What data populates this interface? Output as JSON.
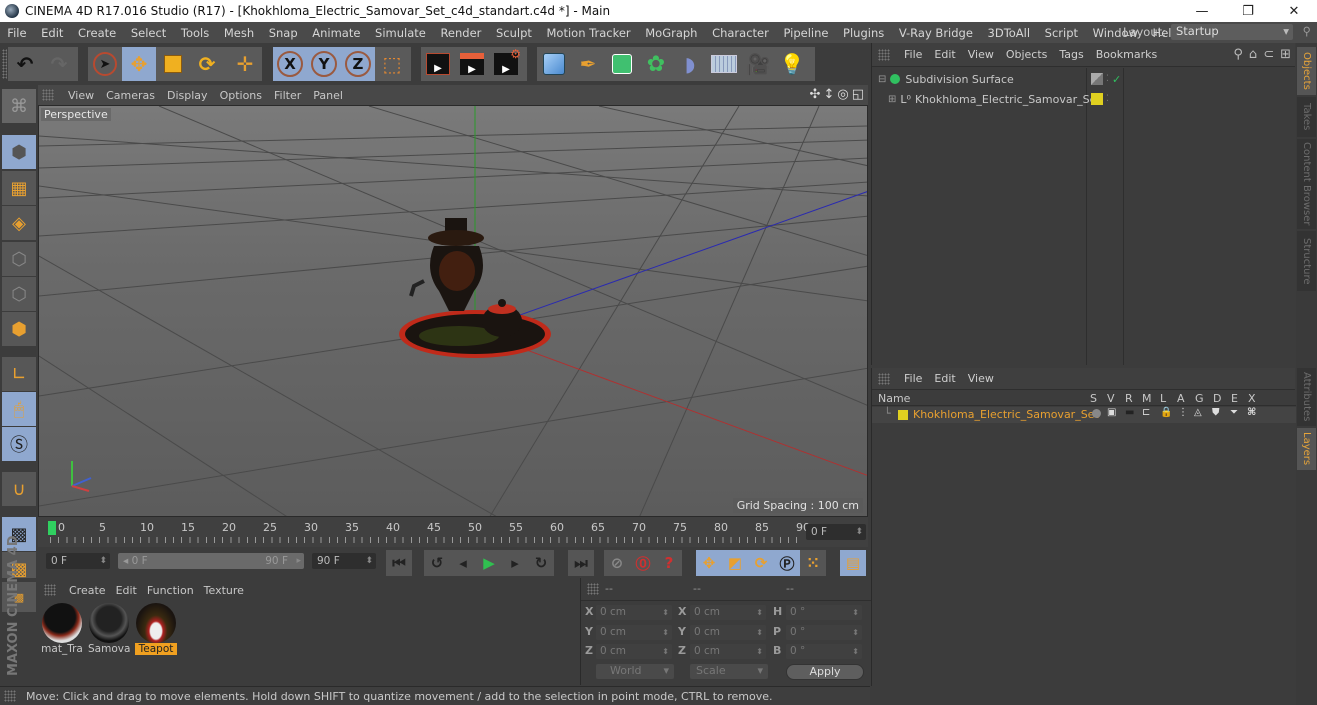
{
  "window": {
    "title": "CINEMA 4D R17.016 Studio (R17) - [Khokhloma_Electric_Samovar_Set_c4d_standart.c4d *] - Main",
    "controls": {
      "minimize": "—",
      "restore": "❐",
      "close": "✕"
    }
  },
  "menubar": {
    "items": [
      "File",
      "Edit",
      "Create",
      "Select",
      "Tools",
      "Mesh",
      "Snap",
      "Animate",
      "Simulate",
      "Render",
      "Sculpt",
      "Motion Tracker",
      "MoGraph",
      "Character",
      "Pipeline",
      "Plugins",
      "V-Ray Bridge",
      "3DToAll",
      "Script",
      "Window",
      "Help"
    ],
    "layout_label": "Layout:",
    "layout_value": "Startup"
  },
  "toolbar": {
    "undo": "undo-icon",
    "redo": "redo-icon",
    "tools": [
      "live-selection",
      "move",
      "scale",
      "rotate",
      "recent-tool"
    ],
    "axes": [
      "X",
      "Y",
      "Z"
    ],
    "render": [
      "render-view",
      "render-picture-viewer",
      "render-settings"
    ],
    "create": [
      "cube",
      "pen",
      "subdivision",
      "cloner",
      "bend",
      "floor",
      "camera",
      "light"
    ]
  },
  "viewport": {
    "menu": [
      "View",
      "Cameras",
      "Display",
      "Options",
      "Filter",
      "Panel"
    ],
    "camera_label": "Perspective",
    "grid_spacing": "Grid Spacing : 100 cm"
  },
  "timeline": {
    "ticks": [
      "0",
      "5",
      "10",
      "15",
      "20",
      "25",
      "30",
      "35",
      "40",
      "45",
      "50",
      "55",
      "60",
      "65",
      "70",
      "75",
      "80",
      "85",
      "90"
    ],
    "current_frame": "0 F",
    "start_field": "0 F",
    "range_start": "0 F",
    "range_end": "90 F",
    "end_field": "90 F"
  },
  "materials": {
    "menu": [
      "Create",
      "Edit",
      "Function",
      "Texture"
    ],
    "items": [
      {
        "label": "mat_Tra",
        "selected": false
      },
      {
        "label": "Samovai",
        "selected": false
      },
      {
        "label": "Teapot",
        "selected": true
      }
    ]
  },
  "coordinates": {
    "headers": [
      "--",
      "--",
      "--"
    ],
    "position": [
      {
        "axis": "X",
        "value": "0 cm"
      },
      {
        "axis": "Y",
        "value": "0 cm"
      },
      {
        "axis": "Z",
        "value": "0 cm"
      }
    ],
    "size": [
      {
        "axis": "X",
        "value": "0 cm"
      },
      {
        "axis": "Y",
        "value": "0 cm"
      },
      {
        "axis": "Z",
        "value": "0 cm"
      }
    ],
    "rotation": [
      {
        "axis": "H",
        "value": "0 °"
      },
      {
        "axis": "P",
        "value": "0 °"
      },
      {
        "axis": "B",
        "value": "0 °"
      }
    ],
    "mode": "World",
    "scale_mode": "Scale",
    "apply": "Apply"
  },
  "status": "Move: Click and drag to move elements. Hold down SHIFT to quantize movement / add to the selection in point mode, CTRL to remove.",
  "objects_panel": {
    "menu": [
      "File",
      "Edit",
      "View",
      "Objects",
      "Tags",
      "Bookmarks"
    ],
    "items": [
      {
        "name": "Subdivision Surface",
        "icon": "subdivision-icon"
      },
      {
        "name": "Khokhloma_Electric_Samovar_Set",
        "icon": "null-object-icon"
      }
    ]
  },
  "layers_panel": {
    "menu": [
      "File",
      "Edit",
      "View"
    ],
    "columns": [
      "Name",
      "S",
      "V",
      "R",
      "M",
      "L",
      "A",
      "G",
      "D",
      "E",
      "X"
    ],
    "items": [
      {
        "name": "Khokhloma_Electric_Samovar_Set",
        "color": "#e0d020"
      }
    ]
  },
  "side_tabs": {
    "top": [
      "Objects",
      "Takes",
      "Content Browser",
      "Structure"
    ],
    "bottom": [
      "Attributes",
      "Layers"
    ]
  },
  "branding": "MAXON CINEMA 4D",
  "colors": {
    "accent_blue": "#8fa8cf",
    "orange": "#e8a030",
    "selected_label": "#f0a020",
    "layer_text": "#e8a030"
  }
}
